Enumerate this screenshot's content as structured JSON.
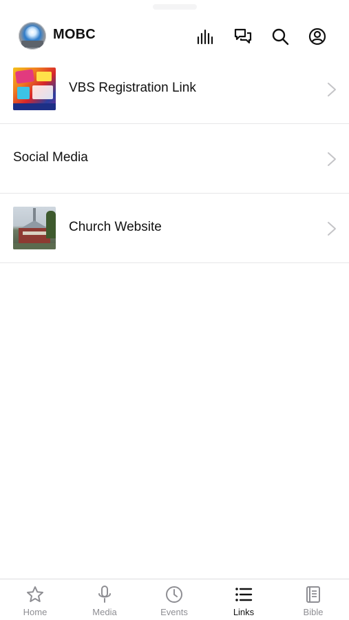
{
  "header": {
    "app_title": "MOBC",
    "icons": [
      "logo-avatar",
      "audio-bars-icon",
      "chat-icon",
      "search-icon",
      "account-icon"
    ]
  },
  "links": [
    {
      "label": "VBS Registration Link",
      "thumbnail": "vbs-flyer-image"
    },
    {
      "label": "Social Media",
      "thumbnail": null
    },
    {
      "label": "Church Website",
      "thumbnail": "church-building-image"
    }
  ],
  "tabbar": {
    "tabs": [
      {
        "label": "Home",
        "icon": "star-icon",
        "active": false
      },
      {
        "label": "Media",
        "icon": "microphone-icon",
        "active": false
      },
      {
        "label": "Events",
        "icon": "clock-icon",
        "active": false
      },
      {
        "label": "Links",
        "icon": "list-icon",
        "active": true
      },
      {
        "label": "Bible",
        "icon": "book-icon",
        "active": false
      }
    ]
  },
  "colors": {
    "text": "#111111",
    "inactive_tab": "#8e8e93",
    "divider": "#e6e6e8",
    "chevron": "#c4c4c7"
  }
}
